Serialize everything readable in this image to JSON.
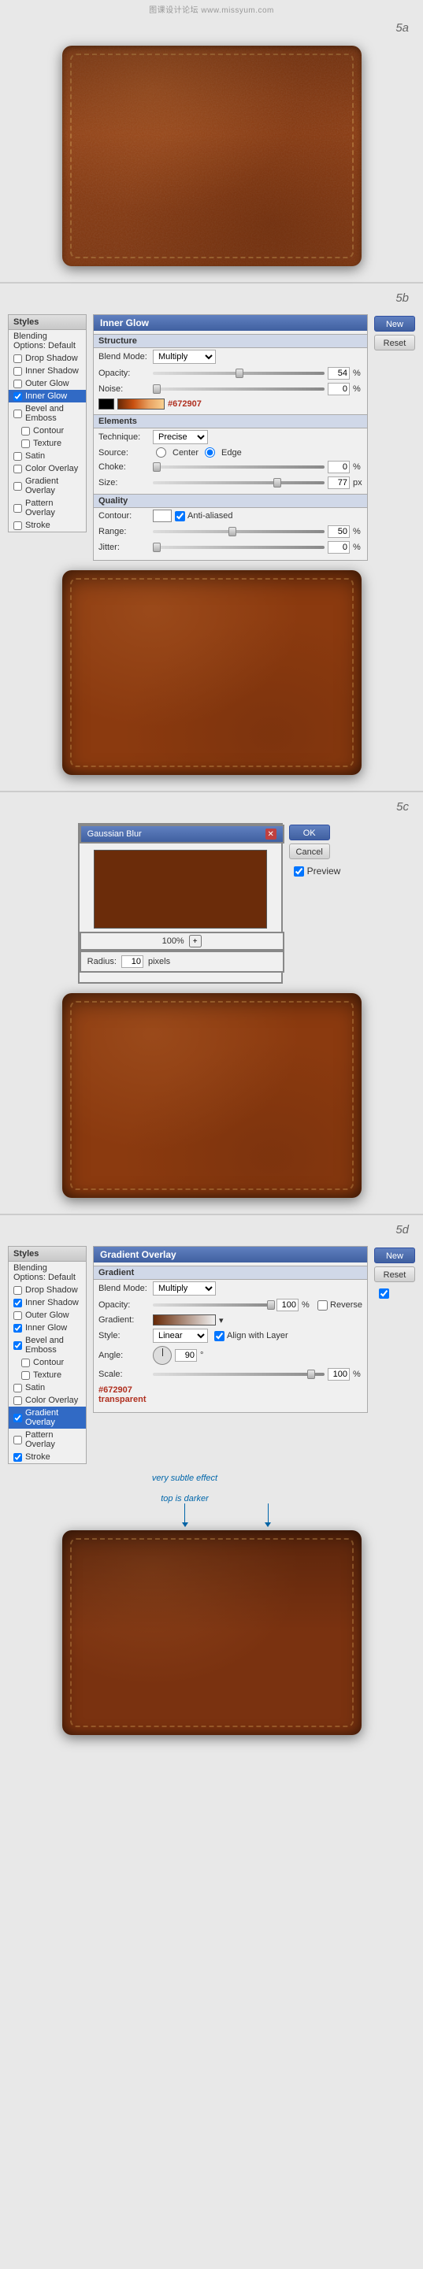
{
  "watermark": "图课设计论坛 www.missyum.com",
  "sections": {
    "5a_label": "5a",
    "5b_label": "5b",
    "5c_label": "5c",
    "5d_label": "5d"
  },
  "styles_panel": {
    "title": "Styles",
    "header": "Blending Options: Default",
    "items": [
      {
        "label": "Drop Shadow",
        "checked": false,
        "active": false
      },
      {
        "label": "Inner Shadow",
        "checked": false,
        "active": false
      },
      {
        "label": "Outer Glow",
        "checked": false,
        "active": false
      },
      {
        "label": "Inner Glow",
        "checked": true,
        "active": true
      },
      {
        "label": "Bevel and Emboss",
        "checked": false,
        "active": false
      },
      {
        "label": "Contour",
        "checked": false,
        "active": false
      },
      {
        "label": "Texture",
        "checked": false,
        "active": false
      },
      {
        "label": "Satin",
        "checked": false,
        "active": false
      },
      {
        "label": "Color Overlay",
        "checked": false,
        "active": false
      },
      {
        "label": "Gradient Overlay",
        "checked": false,
        "active": false
      },
      {
        "label": "Pattern Overlay",
        "checked": false,
        "active": false
      },
      {
        "label": "Stroke",
        "checked": false,
        "active": false
      }
    ]
  },
  "styles_panel_5d": {
    "title": "Styles",
    "header": "Blending Options: Default",
    "items": [
      {
        "label": "Drop Shadow",
        "checked": false,
        "active": false
      },
      {
        "label": "Inner Shadow",
        "checked": true,
        "active": false
      },
      {
        "label": "Outer Glow",
        "checked": false,
        "active": false
      },
      {
        "label": "Inner Glow",
        "checked": true,
        "active": false
      },
      {
        "label": "Bevel and Emboss",
        "checked": true,
        "active": false
      },
      {
        "label": "Contour",
        "checked": false,
        "active": false
      },
      {
        "label": "Texture",
        "checked": false,
        "active": false
      },
      {
        "label": "Satin",
        "checked": false,
        "active": false
      },
      {
        "label": "Color Overlay",
        "checked": false,
        "active": false
      },
      {
        "label": "Gradient Overlay",
        "checked": true,
        "active": true
      },
      {
        "label": "Pattern Overlay",
        "checked": false,
        "active": false
      },
      {
        "label": "Stroke",
        "checked": true,
        "active": false
      }
    ]
  },
  "inner_glow": {
    "title": "Inner Glow",
    "structure_label": "Structure",
    "blend_mode_label": "Blend Mode:",
    "blend_mode_value": "Multiply",
    "opacity_label": "Opacity:",
    "opacity_value": "54",
    "noise_label": "Noise:",
    "noise_value": "0",
    "color_hex": "#672907",
    "elements_label": "Elements",
    "technique_label": "Technique:",
    "technique_value": "Precise",
    "source_label": "Source:",
    "source_center": "Center",
    "source_edge": "Edge",
    "choke_label": "Choke:",
    "choke_value": "0",
    "size_label": "Size:",
    "size_value": "77",
    "size_unit": "px",
    "quality_label": "Quality",
    "contour_label": "Contour:",
    "anti_aliased": "Anti-aliased",
    "range_label": "Range:",
    "range_value": "50",
    "jitter_label": "Jitter:",
    "jitter_value": "0",
    "percent": "%"
  },
  "gradient_overlay": {
    "title": "Gradient Overlay",
    "gradient_label": "Gradient",
    "blend_mode_label": "Blend Mode:",
    "blend_mode_value": "Multiply",
    "opacity_label": "Opacity:",
    "opacity_value": "100",
    "reverse_label": "Reverse",
    "gradient_label2": "Gradient:",
    "style_label": "Style:",
    "style_value": "Linear",
    "align_layer_label": "Align with Layer",
    "angle_label": "Angle:",
    "angle_value": "90",
    "scale_label": "Scale:",
    "scale_value": "100",
    "color_annotation": "#672907",
    "transparent_annotation": "transparent"
  },
  "gaussian_blur": {
    "title": "Gaussian Blur",
    "ok_label": "OK",
    "cancel_label": "Cancel",
    "preview_label": "Preview",
    "radius_label": "Radius:",
    "radius_value": "10",
    "pixels_label": "pixels",
    "zoom_label": "100%"
  },
  "buttons": {
    "new_label": "New",
    "reset_label": "Reset"
  },
  "annotations": {
    "color_hex": "#672907",
    "very_subtle": "very subtle effect",
    "top_darker": "top is darker"
  }
}
